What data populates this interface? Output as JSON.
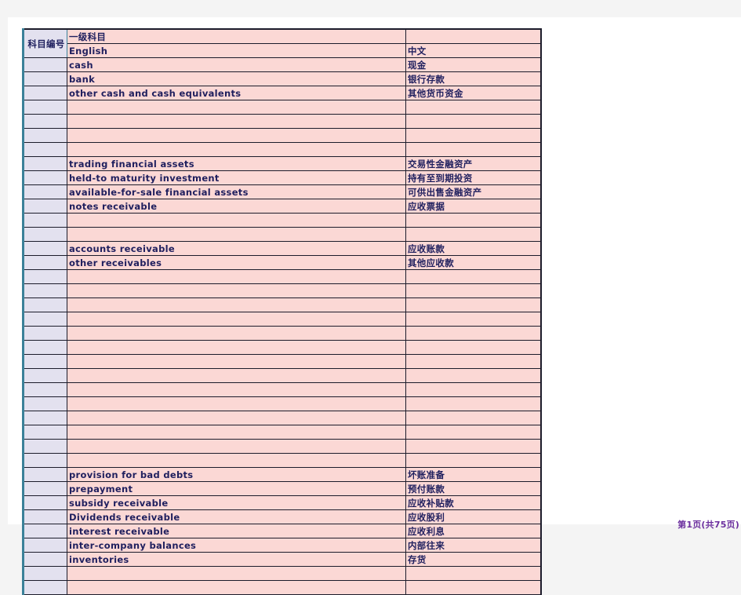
{
  "document": {
    "type": "spreadsheet-print-preview",
    "footer_label": "第1页(共75页)"
  },
  "colors": {
    "page_background": "#f4f4f4",
    "paper": "#ffffff",
    "code_column_fill": "#e3e1ef",
    "text_column_fill": "#fbd8d5",
    "text": "#1f1f5e",
    "accent_border": "#3b8199",
    "grid_dark": "#1c1c2b",
    "grid_soft": "#a98e8e",
    "footer_text": "#6b2f9e"
  },
  "table": {
    "columns": [
      {
        "key": "code",
        "header": "科目编号"
      },
      {
        "key": "en",
        "header": "一级科目"
      },
      {
        "key": "cn",
        "header": ""
      }
    ],
    "rows": [
      {
        "code": "科目编号",
        "en": "一级科目",
        "cn": "",
        "merge_code": true,
        "sep": "soft"
      },
      {
        "code": "",
        "en": "English",
        "cn": "中文",
        "sep": "dark"
      },
      {
        "code": "",
        "en": "cash",
        "cn": "现金",
        "sep": "dark"
      },
      {
        "code": "",
        "en": "bank",
        "cn": "银行存款",
        "sep": "dark"
      },
      {
        "code": "",
        "en": "other cash and cash equivalents",
        "cn": "其他货币资金",
        "sep": "soft"
      },
      {
        "code": "",
        "en": "",
        "cn": "",
        "sep": "dark"
      },
      {
        "code": "",
        "en": "",
        "cn": "",
        "sep": "soft"
      },
      {
        "code": "",
        "en": "",
        "cn": "",
        "sep": "dark"
      },
      {
        "code": "",
        "en": "",
        "cn": "",
        "sep": "dark"
      },
      {
        "code": "",
        "en": "trading financial assets",
        "cn": "交易性金融资产",
        "sep": "soft"
      },
      {
        "code": "",
        "en": "held-to maturity investment",
        "cn": "持有至到期投资",
        "sep": "dark"
      },
      {
        "code": "",
        "en": "available-for-sale financial assets",
        "cn": "可供出售金融资产",
        "sep": "dark"
      },
      {
        "code": "",
        "en": "notes receivable",
        "cn": "应收票据",
        "sep": "dark"
      },
      {
        "code": "",
        "en": "",
        "cn": "",
        "sep": "soft"
      },
      {
        "code": "",
        "en": "",
        "cn": "",
        "sep": "teal"
      },
      {
        "code": "",
        "en": "accounts receivable",
        "cn": "应收账款",
        "sep": "dark"
      },
      {
        "code": "",
        "en": "other receivables",
        "cn": "其他应收款",
        "sep": "dark"
      },
      {
        "code": "",
        "en": "",
        "cn": "",
        "sep": "dark"
      },
      {
        "code": "",
        "en": "",
        "cn": "",
        "sep": "soft"
      },
      {
        "code": "",
        "en": "",
        "cn": "",
        "sep": "dark"
      },
      {
        "code": "",
        "en": "",
        "cn": "",
        "sep": "dark"
      },
      {
        "code": "",
        "en": "",
        "cn": "",
        "sep": "soft"
      },
      {
        "code": "",
        "en": "",
        "cn": "",
        "sep": "dark"
      },
      {
        "code": "",
        "en": "",
        "cn": "",
        "sep": "dark"
      },
      {
        "code": "",
        "en": "",
        "cn": "",
        "sep": "dark"
      },
      {
        "code": "",
        "en": "",
        "cn": "",
        "sep": "soft"
      },
      {
        "code": "",
        "en": "",
        "cn": "",
        "sep": "dark"
      },
      {
        "code": "",
        "en": "",
        "cn": "",
        "sep": "dark"
      },
      {
        "code": "",
        "en": "",
        "cn": "",
        "sep": "dark"
      },
      {
        "code": "",
        "en": "",
        "cn": "",
        "sep": "dark"
      },
      {
        "code": "",
        "en": "",
        "cn": "",
        "sep": "soft"
      },
      {
        "code": "",
        "en": "provision for bad debts",
        "cn": "坏账准备",
        "sep": "dark"
      },
      {
        "code": "",
        "en": "prepayment",
        "cn": "预付账款",
        "sep": "dark"
      },
      {
        "code": "",
        "en": "subsidy receivable",
        "cn": "应收补贴款",
        "sep": "dark"
      },
      {
        "code": "",
        "en": "Dividends receivable",
        "cn": "应收股利",
        "sep": "dark"
      },
      {
        "code": "",
        "en": "interest receivable",
        "cn": "应收利息",
        "sep": "dark"
      },
      {
        "code": "",
        "en": "inter-company balances",
        "cn": "内部往来",
        "sep": "dark"
      },
      {
        "code": "",
        "en": "inventories",
        "cn": "存货",
        "sep": "dark"
      },
      {
        "code": "",
        "en": "",
        "cn": "",
        "sep": "soft"
      },
      {
        "code": "",
        "en": "",
        "cn": "",
        "sep": "dark"
      }
    ]
  }
}
